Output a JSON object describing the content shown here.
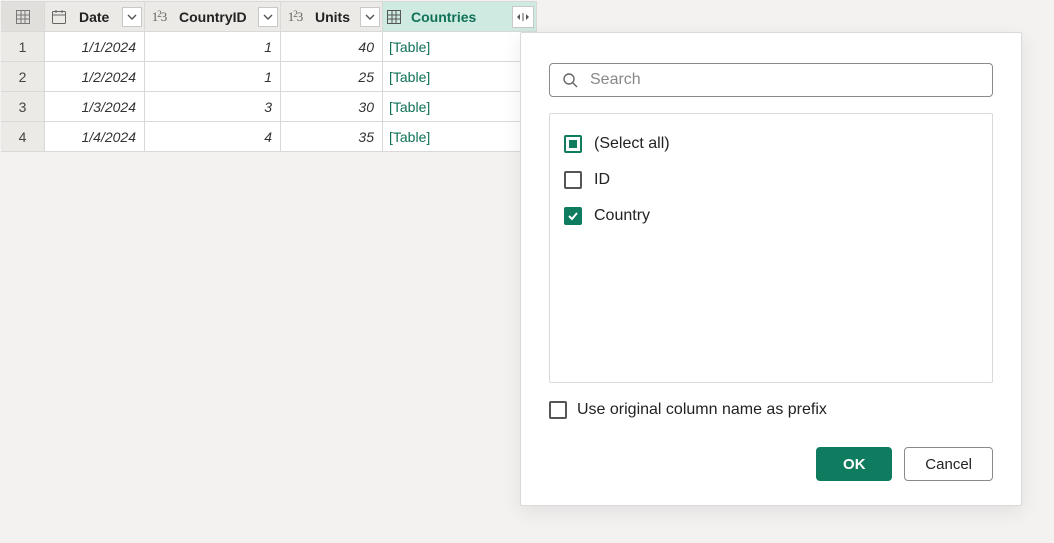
{
  "columns": {
    "date": {
      "label": "Date"
    },
    "countryId": {
      "label": "CountryID"
    },
    "units": {
      "label": "Units"
    },
    "countries": {
      "label": "Countries"
    }
  },
  "rows": [
    {
      "n": "1",
      "date": "1/1/2024",
      "cid": "1",
      "units": "40",
      "countries": "[Table]"
    },
    {
      "n": "2",
      "date": "1/2/2024",
      "cid": "1",
      "units": "25",
      "countries": "[Table]"
    },
    {
      "n": "3",
      "date": "1/3/2024",
      "cid": "3",
      "units": "30",
      "countries": "[Table]"
    },
    {
      "n": "4",
      "date": "1/4/2024",
      "cid": "4",
      "units": "35",
      "countries": "[Table]"
    }
  ],
  "popup": {
    "search_placeholder": "Search",
    "options": {
      "select_all": "(Select all)",
      "id": "ID",
      "country": "Country"
    },
    "prefix_label": "Use original column name as prefix",
    "ok_label": "OK",
    "cancel_label": "Cancel"
  }
}
